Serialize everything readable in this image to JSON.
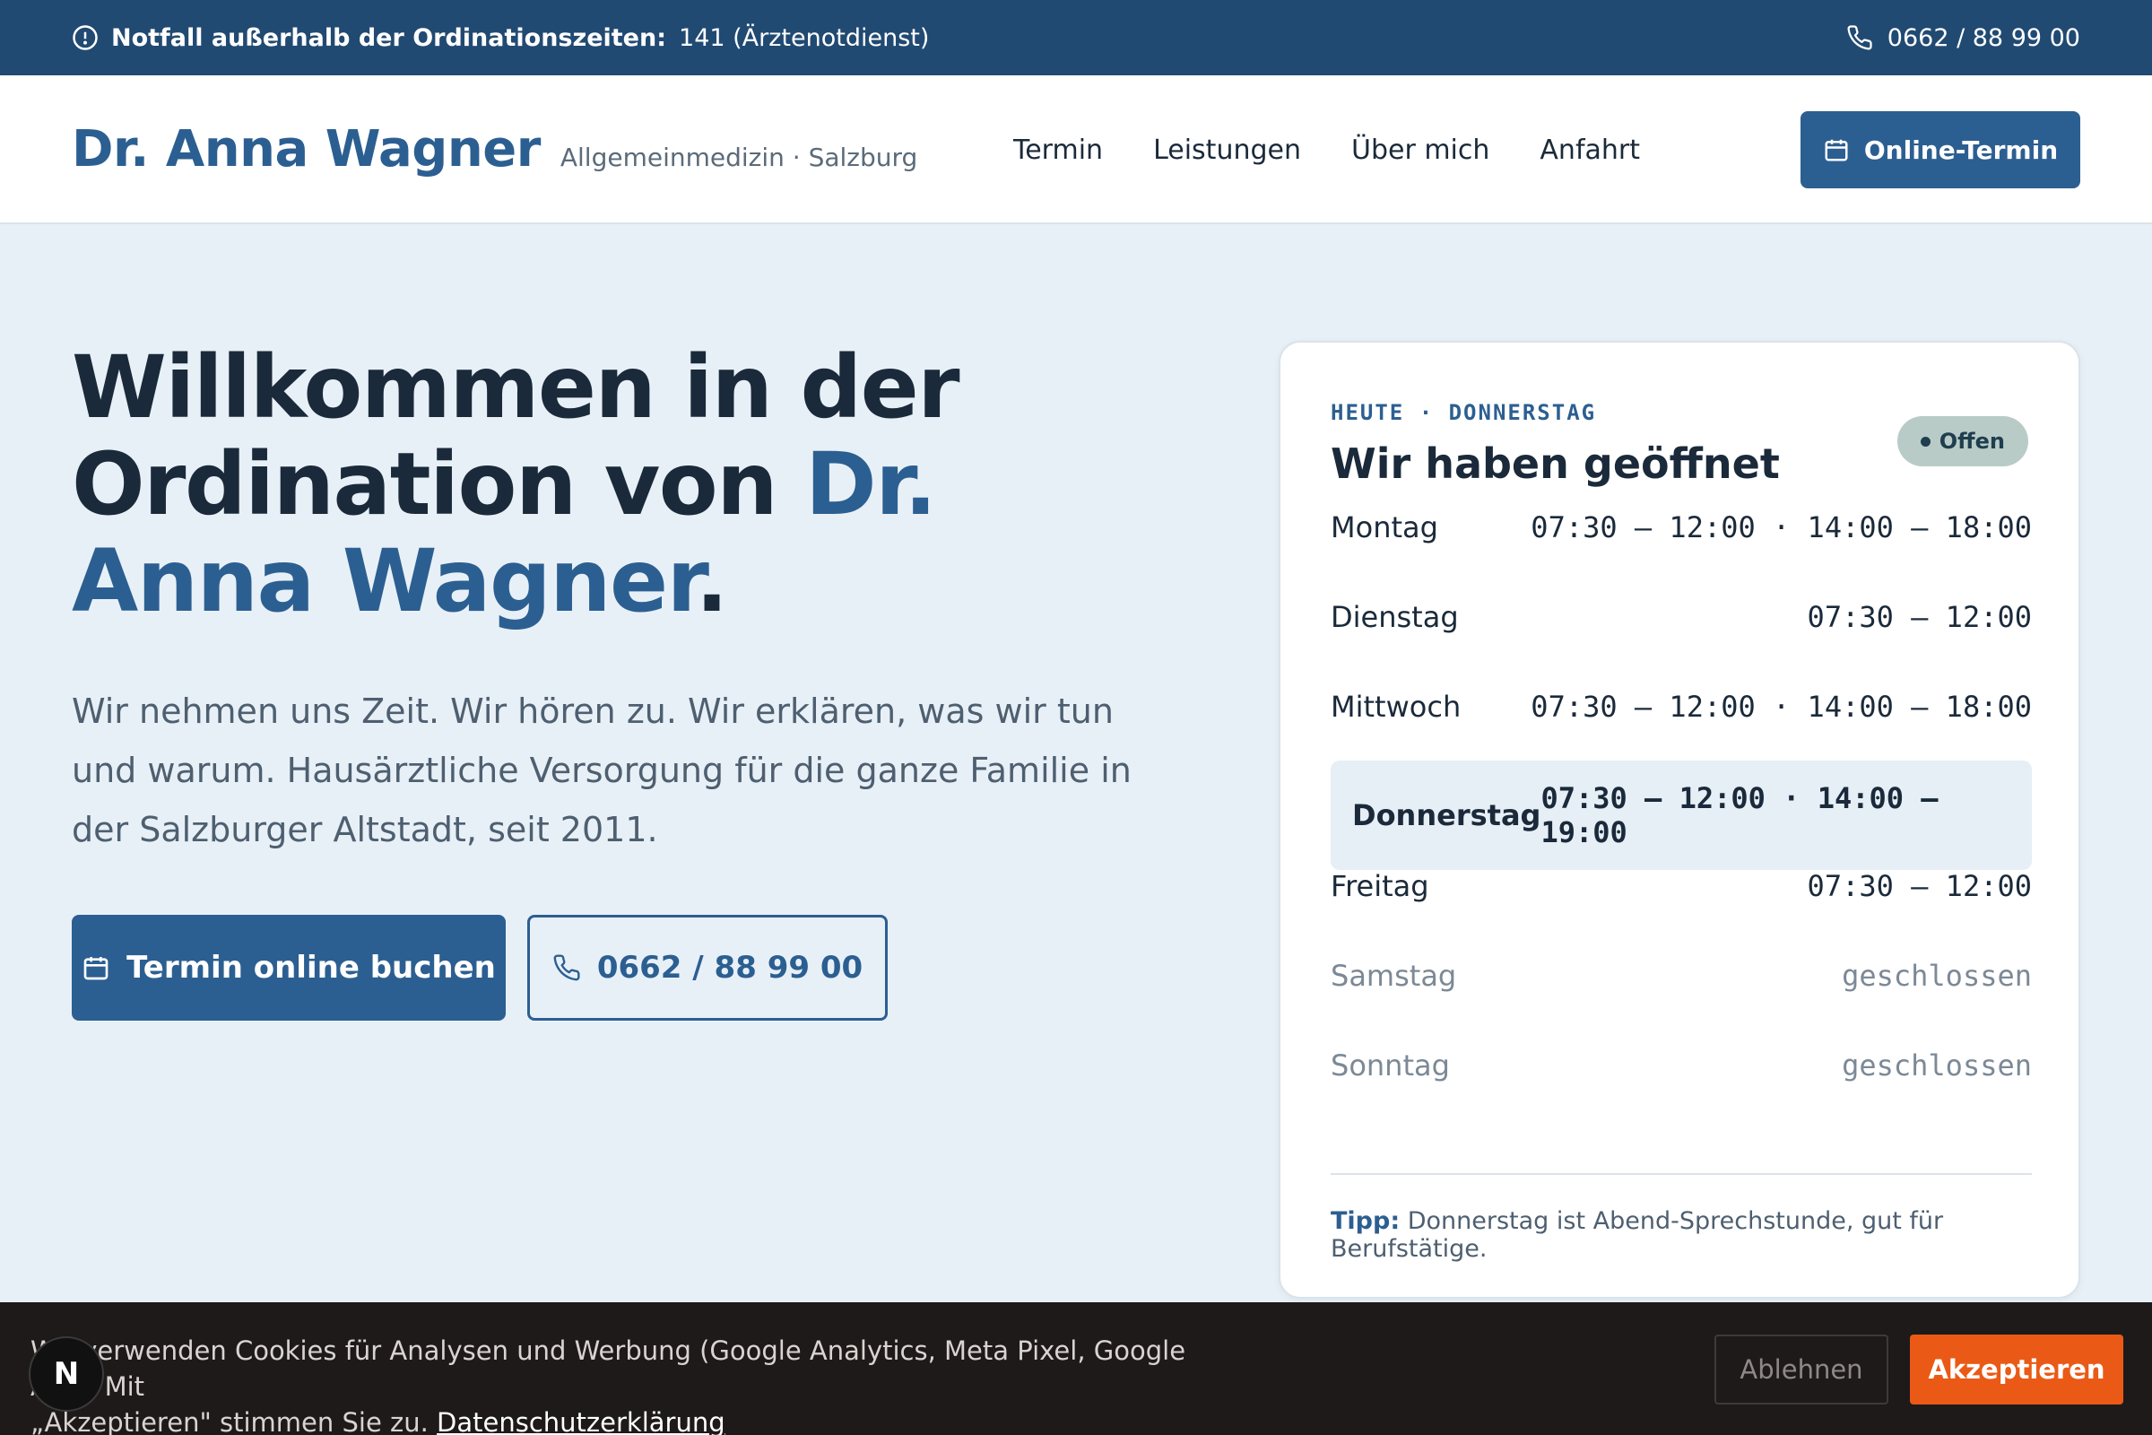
{
  "topbar": {
    "emergency_label": "Notfall außerhalb der Ordinationszeiten:",
    "emergency_value": "141 (Ärztenotdienst)",
    "phone": "0662 / 88 99 00"
  },
  "header": {
    "brand_name": "Dr. Anna Wagner",
    "brand_sub": "Allgemeinmedizin · Salzburg",
    "nav": [
      "Termin",
      "Leistungen",
      "Über mich",
      "Anfahrt"
    ],
    "cta": "Online-Termin"
  },
  "hero": {
    "title_part1": "Willkommen in der Ordination von ",
    "title_accent": "Dr. Anna Wagner",
    "title_end": ".",
    "text": "Wir nehmen uns Zeit. Wir hören zu. Wir erklären, was wir tun und warum. Hausärztliche Versorgung für die ganze Familie in der Salzburger Altstadt, seit 2011.",
    "primary_button": "Termin online buchen",
    "phone_button": "0662 / 88 99 00"
  },
  "hours": {
    "eyebrow": "HEUTE · DONNERSTAG",
    "title": "Wir haben geöffnet",
    "status": "Offen",
    "rows": [
      {
        "day": "Montag",
        "time": "07:30 – 12:00 · 14:00 – 18:00"
      },
      {
        "day": "Dienstag",
        "time": "07:30 – 12:00"
      },
      {
        "day": "Mittwoch",
        "time": "07:30 – 12:00 · 14:00 – 18:00"
      },
      {
        "day": "Donnerstag",
        "time": "07:30 – 12:00 · 14:00 – 19:00"
      },
      {
        "day": "Freitag",
        "time": "07:30 – 12:00"
      },
      {
        "day": "Samstag",
        "time": "geschlossen"
      },
      {
        "day": "Sonntag",
        "time": "geschlossen"
      }
    ],
    "tip_label": "Tipp:",
    "tip_text": "Donnerstag ist Abend-Sprechstunde, gut für Berufstätige."
  },
  "cookie": {
    "text_line1": "Wir verwenden Cookies für Analysen und Werbung (Google Analytics, Meta Pixel, Google Ads). Mit",
    "text_line2": "„Akzeptieren\" stimmen Sie zu.",
    "link": "Datenschutzerklärung",
    "decline": "Ablehnen",
    "accept": "Akzeptieren",
    "dev_badge": "N"
  },
  "colors": {
    "brand": "#2c5f91",
    "topbar": "#214a72",
    "accept": "#ea5a16"
  }
}
